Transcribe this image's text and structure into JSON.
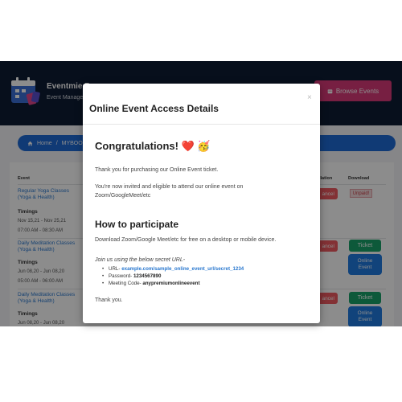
{
  "app": {
    "title": "Eventmie Pro",
    "subtitle": "Event Managem",
    "browse_button": "Browse Events"
  },
  "breadcrumb": {
    "home": "Home",
    "sep": "/",
    "current": "MYBOOKIN"
  },
  "table": {
    "headers": {
      "event": "Event",
      "cancellation": "llation",
      "download": "Download"
    },
    "timings_label": "Timings",
    "rows": [
      {
        "event_line1": "Regular Yoga Classes",
        "event_line2": "(Yoga & Health)",
        "dates": "Nov 15,21 - Nov 25,21",
        "times": "07:00 AM - 08:30 AM",
        "cancel_label": "ancel",
        "download_label": "Unpaid!"
      },
      {
        "event_line1": "Daily Meditation Classes",
        "event_line2": "(Yoga & Health)",
        "dates": "Jun 08,20 - Jun 08,20",
        "times": "05:00 AM - 06:00 AM",
        "cancel_label": "ancel",
        "ticket_label": "Ticket",
        "online_label_1": "Online",
        "online_label_2": "Event"
      },
      {
        "event_line1": "Daily Meditation Classes",
        "event_line2": "(Yoga & Health)",
        "dates": "Jun 08,20 - Jun 08,20",
        "cancel_label": "ancel",
        "ticket_label": "Ticket",
        "online_label_1": "Online",
        "online_label_2": "Event"
      }
    ]
  },
  "modal": {
    "title": "Online Event Access Details",
    "close": "×",
    "congrats_heading": "Congratulations! ❤️ 🥳",
    "thank_you_purchase": "Thank you for purchasing our Online Event ticket.",
    "invite_line1": "You're now invited and eligible to attend our online event on",
    "invite_line2": "Zoom/GoogleMeet/etc",
    "how_heading": "How to participate",
    "download_text": "Download Zoom/Google Meet/etc for free on a desktop or mobile device.",
    "join_text": "Join us using the below secret URL-",
    "url_label": "URL-",
    "url_value": "example.com/sample_online_event_url/secret_1234",
    "password_label": "Password-",
    "password_value": "1234567890",
    "meeting_label": "Meeting Code-",
    "meeting_value": "anypremiumonlineevent",
    "thanks": "Thank you."
  },
  "colors": {
    "header_bg": "#0e1c33",
    "browse_btn": "#d93a78",
    "breadcrumb_bg": "#1e6ad6",
    "cancel_btn": "#ef5a61",
    "ticket_btn": "#19a36a",
    "online_btn": "#1f7be0",
    "link": "#2a78cf"
  }
}
